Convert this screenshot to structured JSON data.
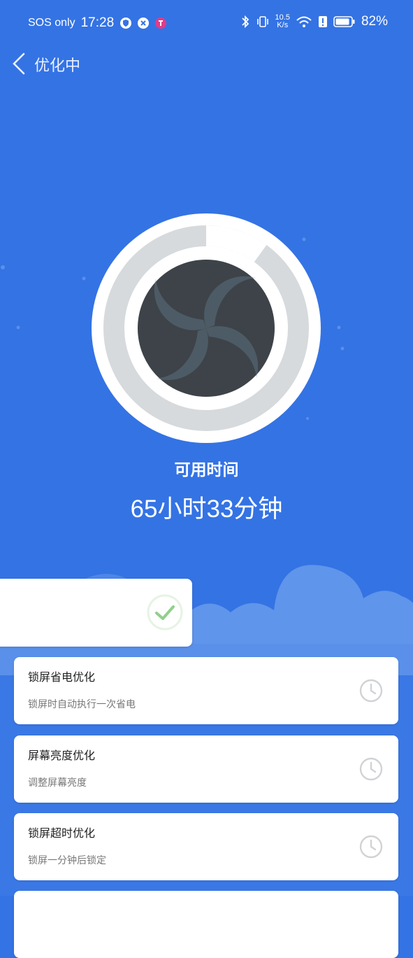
{
  "status_bar": {
    "carrier": "SOS only",
    "time": "17:28",
    "net_speed_value": "10.5",
    "net_speed_unit": "K/s",
    "battery_percent": "82%"
  },
  "header": {
    "title": "优化中"
  },
  "dial": {
    "progress_fraction": 0.1,
    "ring_color": "#d6dadd",
    "progress_color": "#ffffff",
    "fan_color": "#3d4348"
  },
  "summary": {
    "label": "可用时间",
    "value": "65小时33分钟"
  },
  "tasks": [
    {
      "title": "锁屏省电优化",
      "desc": "锁屏时自动执行一次省电",
      "status_icon": "clock-icon"
    },
    {
      "title": "屏幕亮度优化",
      "desc": "调整屏幕亮度",
      "status_icon": "clock-icon"
    },
    {
      "title": "锁屏超时优化",
      "desc": "锁屏一分钟后锁定",
      "status_icon": "clock-icon"
    }
  ],
  "colors": {
    "background": "#3473e4",
    "check_green": "#8fd08a"
  }
}
